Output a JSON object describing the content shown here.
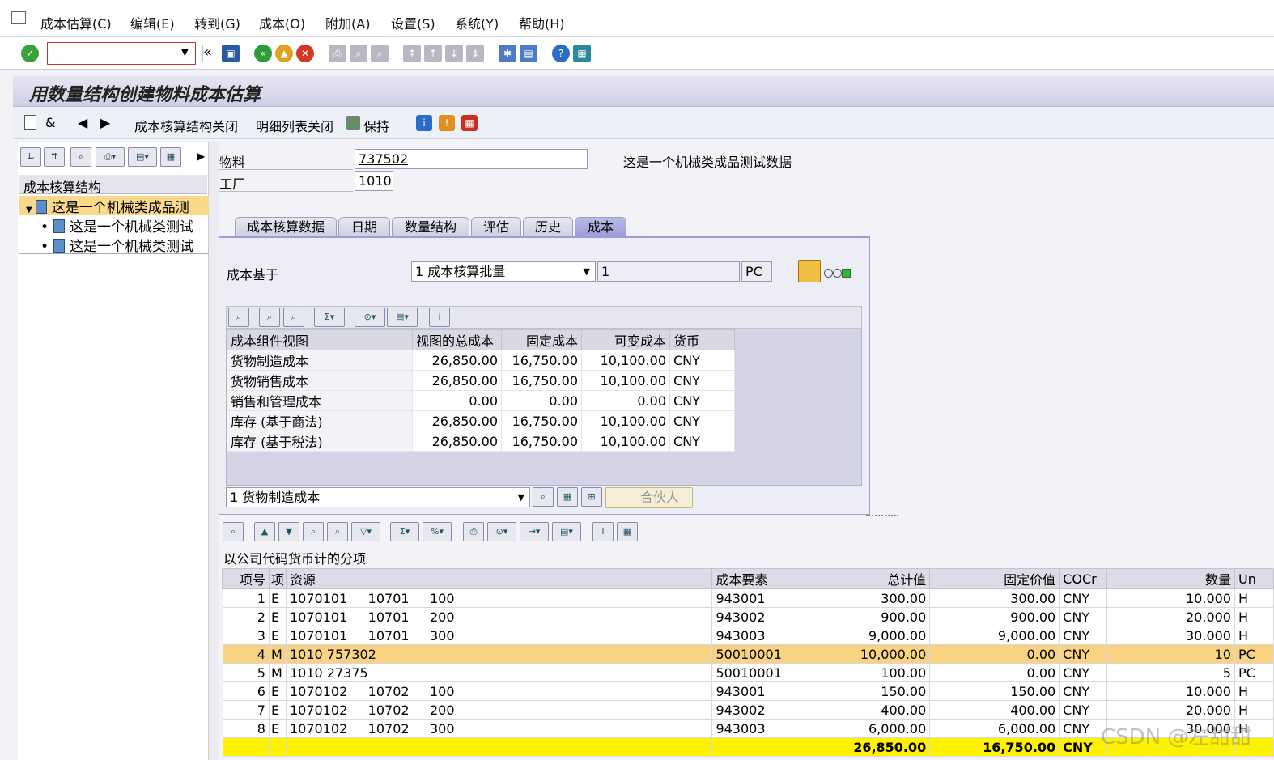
{
  "menu": [
    "成本估算(C)",
    "编辑(E)",
    "转到(G)",
    "成本(O)",
    "附加(A)",
    "设置(S)",
    "系统(Y)",
    "帮助(H)"
  ],
  "title": "用数量结构创建物料成本估算",
  "app_toolbar": {
    "close_structure": "成本核算结构关闭",
    "close_itemization": "明细列表关闭",
    "hold": "保持"
  },
  "tree": {
    "header": "成本核算结构",
    "nodes": [
      "这是一个机械类成品测",
      "这是一个机械类测试",
      "这是一个机械类测试"
    ]
  },
  "header_fields": {
    "material_label": "物料",
    "material_value": "737502",
    "material_desc": "这是一个机械类成品测试数据",
    "plant_label": "工厂",
    "plant_value": "1010"
  },
  "tabs": [
    "成本核算数据",
    "日期",
    "数量结构",
    "评估",
    "历史",
    "成本"
  ],
  "active_tab": "成本",
  "cost_base": {
    "label": "成本基于",
    "value": "1 成本核算批量",
    "qty": "1",
    "unit": "PC"
  },
  "cost_component_table": {
    "columns": [
      "成本组件视图",
      "视图的总成本",
      "固定成本",
      "可变成本",
      "货币"
    ],
    "rows": [
      [
        "货物制造成本",
        "26,850.00",
        "16,750.00",
        "10,100.00",
        "CNY"
      ],
      [
        "货物销售成本",
        "26,850.00",
        "16,750.00",
        "10,100.00",
        "CNY"
      ],
      [
        "销售和管理成本",
        "0.00",
        "0.00",
        "0.00",
        "CNY"
      ],
      [
        "库存 (基于商法)",
        "26,850.00",
        "16,750.00",
        "10,100.00",
        "CNY"
      ],
      [
        "库存 (基于税法)",
        "26,850.00",
        "16,750.00",
        "10,100.00",
        "CNY"
      ]
    ]
  },
  "view_select": {
    "value": "1 货物制造成本",
    "partner_label": "合伙人"
  },
  "itemization": {
    "title": "以公司代码货币计的分项",
    "columns": [
      "项号",
      "项",
      "资源",
      "成本要素",
      "总计值",
      "固定价值",
      "COCr",
      "数量",
      "Un"
    ],
    "rows": [
      [
        "1",
        "E",
        "1070101     10701     100",
        "943001",
        "300.00",
        "300.00",
        "CNY",
        "10.000",
        "H"
      ],
      [
        "2",
        "E",
        "1070101     10701     200",
        "943002",
        "900.00",
        "900.00",
        "CNY",
        "20.000",
        "H"
      ],
      [
        "3",
        "E",
        "1070101     10701     300",
        "943003",
        "9,000.00",
        "9,000.00",
        "CNY",
        "30.000",
        "H"
      ],
      [
        "4",
        "M",
        "1010 757302",
        "50010001",
        "10,000.00",
        "0.00",
        "CNY",
        "10",
        "PC"
      ],
      [
        "5",
        "M",
        "1010 27375",
        "50010001",
        "100.00",
        "0.00",
        "CNY",
        "5",
        "PC"
      ],
      [
        "6",
        "E",
        "1070102     10702     100",
        "943001",
        "150.00",
        "150.00",
        "CNY",
        "10.000",
        "H"
      ],
      [
        "7",
        "E",
        "1070102     10702     200",
        "943002",
        "400.00",
        "400.00",
        "CNY",
        "20.000",
        "H"
      ],
      [
        "8",
        "E",
        "1070102     10702     300",
        "943003",
        "6,000.00",
        "6,000.00",
        "CNY",
        "30.000",
        "H"
      ]
    ],
    "highlight_row": 3,
    "total": {
      "total_value": "26,850.00",
      "fixed_value": "16,750.00",
      "currency": "CNY"
    }
  },
  "watermark": "CSDN @左甜甜"
}
